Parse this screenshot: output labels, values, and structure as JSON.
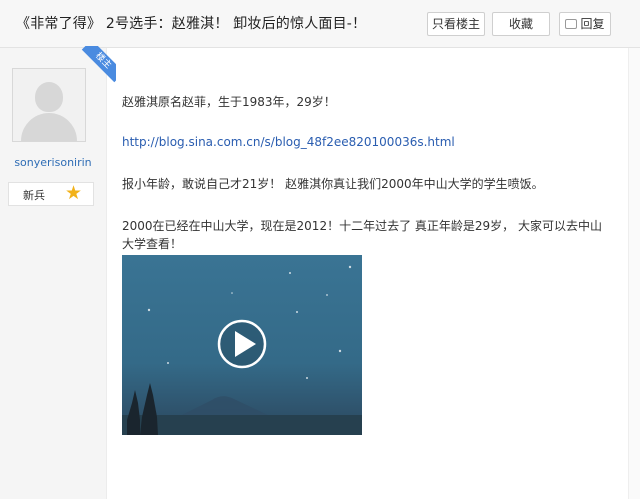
{
  "post": {
    "title": "《非常了得》 2号选手：赵雅淇！    卸妆后的惊人面目-！",
    "paragraphs": [
      "赵雅淇原名赵菲，生于1983年，29岁！",
      "报小年龄，敢说自己才21岁！ 赵雅淇你真让我们2000年中山大学的学生喷饭。",
      "2000在已经在中山大学，现在是2012！十二年过去了 真正年龄是29岁， 大家可以去中山大学查看！"
    ],
    "link": "http://blog.sina.com.cn/s/blog_48f2ee820100036s.html"
  },
  "actions": {
    "only_op": "只看楼主",
    "favorite": "收藏",
    "reply": "回复"
  },
  "author": {
    "username": "sonyerisonirin",
    "rank": "新兵",
    "op_badge": "楼主",
    "rank_icon": "star-icon"
  },
  "colors": {
    "link": "#2a5db0",
    "username": "#2f6db5",
    "badge": "#4a8be0",
    "star": "#f2b21a",
    "video_top": "#3a7494",
    "video_bottom": "#2c475e"
  }
}
